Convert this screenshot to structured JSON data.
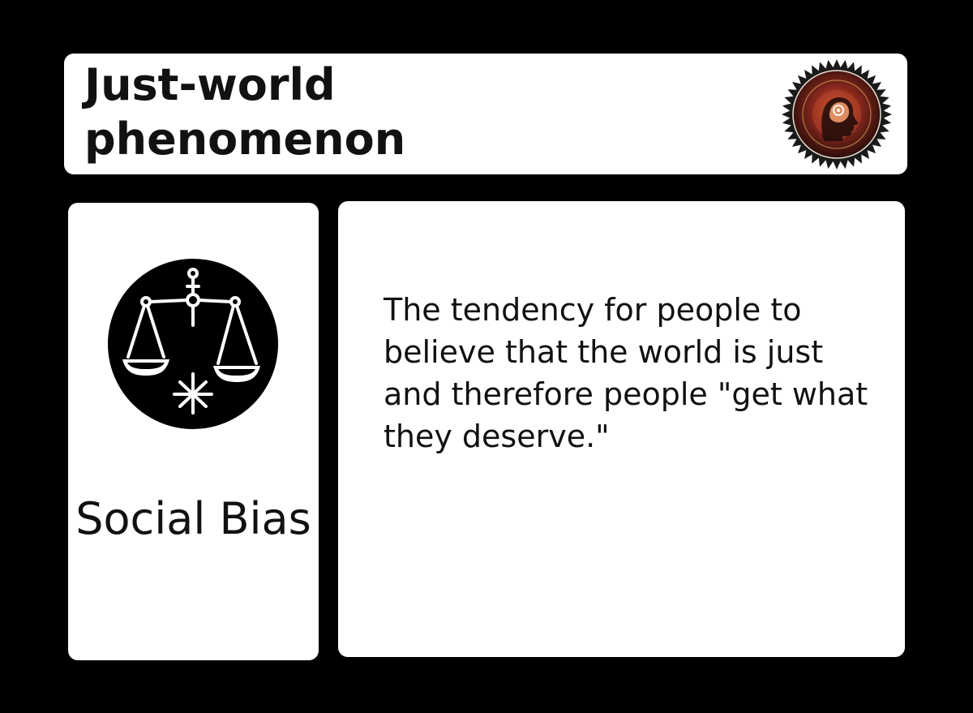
{
  "card": {
    "title": "Just-world phenomenon",
    "category": "Social Bias",
    "description": "The tendency for people to believe that the world is just and therefore people \"get what they deserve.\"",
    "icons": {
      "category": "scales-of-justice-icon",
      "badge": "head-silhouette-seal-icon"
    },
    "colors": {
      "background": "#000000",
      "panel": "#ffffff",
      "text": "#111111",
      "badge_accent": "#c0392b"
    }
  }
}
